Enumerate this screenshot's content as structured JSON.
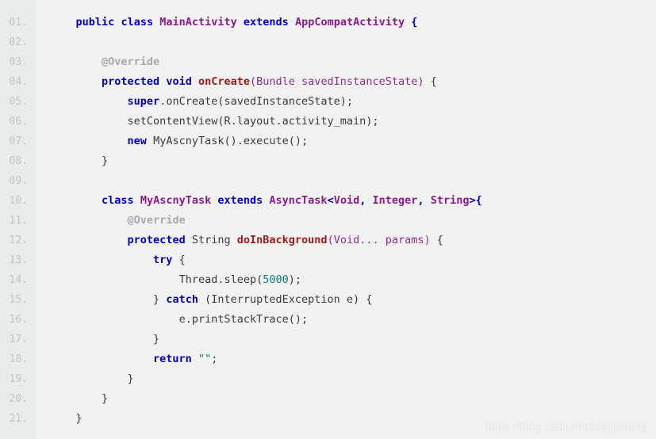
{
  "editor": {
    "language": "java",
    "background_color": "#f1f2f0",
    "gutter_color": "#e7ebea",
    "line_number_color": "#bfc6c9",
    "total_lines": 21,
    "lines": [
      {
        "num": "01.",
        "text": "    public class MainActivity extends AppCompatActivity {"
      },
      {
        "num": "02.",
        "text": ""
      },
      {
        "num": "03.",
        "text": "        @Override"
      },
      {
        "num": "04.",
        "text": "        protected void onCreate(Bundle savedInstanceState) {"
      },
      {
        "num": "05.",
        "text": "            super.onCreate(savedInstanceState);"
      },
      {
        "num": "06.",
        "text": "            setContentView(R.layout.activity_main);"
      },
      {
        "num": "07.",
        "text": "            new MyAscnyTask().execute();"
      },
      {
        "num": "08.",
        "text": "        }"
      },
      {
        "num": "09.",
        "text": ""
      },
      {
        "num": "10.",
        "text": "        class MyAscnyTask extends AsyncTask<Void, Integer, String>{"
      },
      {
        "num": "11.",
        "text": "            @Override"
      },
      {
        "num": "12.",
        "text": "            protected String doInBackground(Void... params) {"
      },
      {
        "num": "13.",
        "text": "                try {"
      },
      {
        "num": "14.",
        "text": "                    Thread.sleep(5000);"
      },
      {
        "num": "15.",
        "text": "                } catch (InterruptedException e) {"
      },
      {
        "num": "16.",
        "text": "                    e.printStackTrace();"
      },
      {
        "num": "17.",
        "text": "                }"
      },
      {
        "num": "18.",
        "text": "                return \"\";"
      },
      {
        "num": "19.",
        "text": "            }"
      },
      {
        "num": "20.",
        "text": "        }"
      },
      {
        "num": "21.",
        "text": "    }"
      }
    ],
    "tokens": {
      "keywords": [
        "public",
        "class",
        "extends",
        "protected",
        "void",
        "super",
        "new",
        "return",
        "try",
        "catch"
      ],
      "types": [
        "MainActivity",
        "AppCompatActivity",
        "MyAscnyTask",
        "AsyncTask",
        "Void",
        "Integer",
        "String"
      ],
      "methods": [
        "onCreate",
        "doInBackground"
      ],
      "annotations": [
        "@Override"
      ],
      "numbers": [
        "5000"
      ],
      "strings": [
        "\"\""
      ],
      "keyword_color": "#0000c0",
      "type_color": "#8b1a8b",
      "method_color": "#9c1a1a",
      "annotation_color": "#a8aaa6",
      "number_color": "#0b7f7f",
      "string_color": "#0b7f7f",
      "plain_color": "#3a3a3a"
    }
  },
  "watermark": {
    "text": "https://blog.csdn.net/tangjianing"
  }
}
